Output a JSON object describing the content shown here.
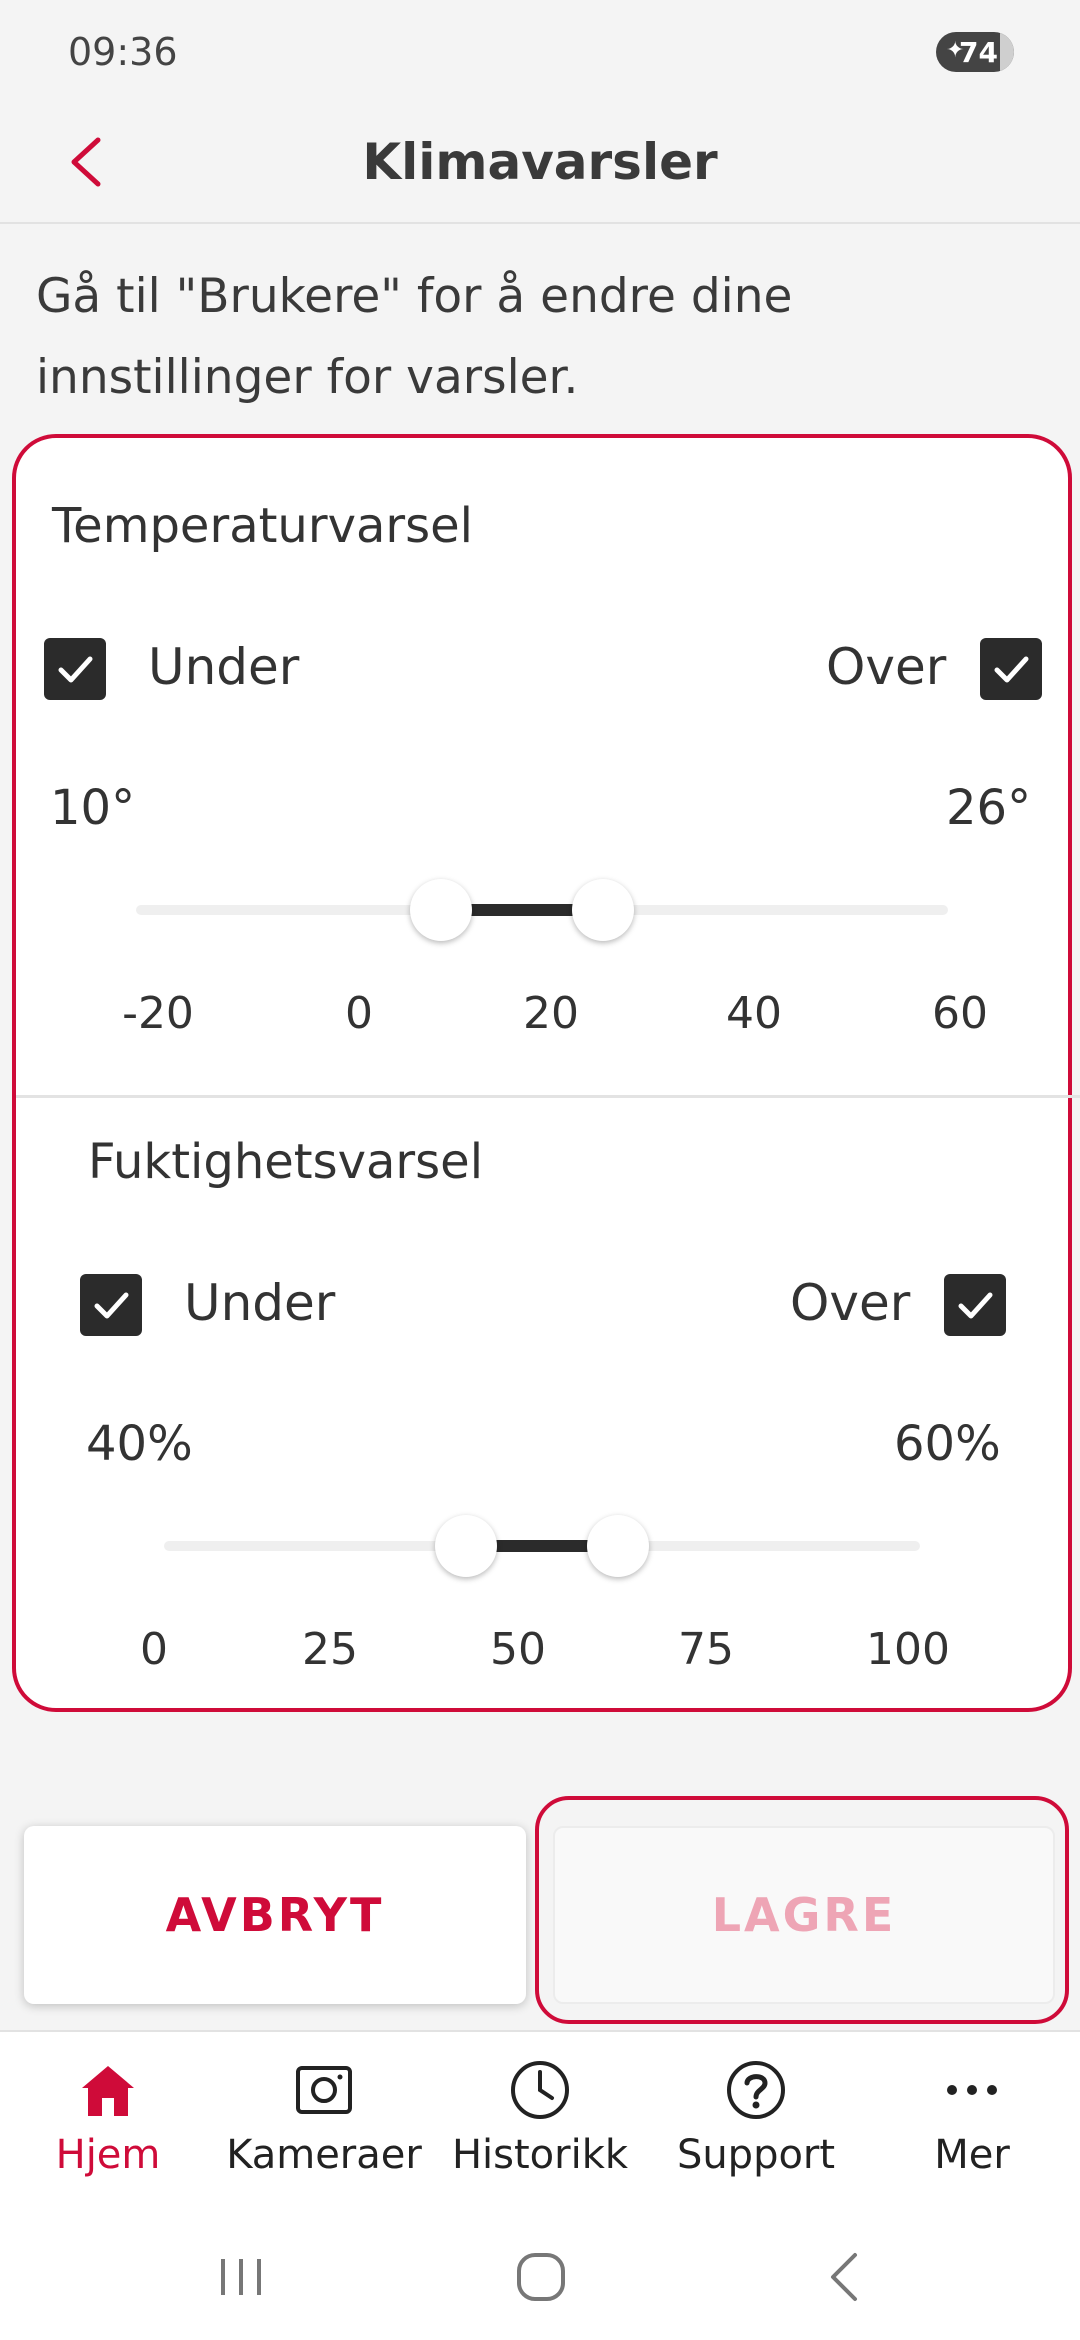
{
  "status_bar": {
    "time": "09:36",
    "battery_level": "74"
  },
  "header": {
    "title": "Klimavarsler"
  },
  "info": {
    "text": "Gå til \"Brukere\" for å endre dine innstillinger for varsler."
  },
  "temperature": {
    "title": "Temperaturvarsel",
    "under_label": "Under",
    "over_label": "Over",
    "under_checked": true,
    "over_checked": true,
    "low_value": "10°",
    "high_value": "26°",
    "slider": {
      "min": -20,
      "max": 60,
      "low": 10,
      "high": 26
    },
    "ticks": [
      "-20",
      "0",
      "20",
      "40",
      "60"
    ]
  },
  "humidity": {
    "title": "Fuktighetsvarsel",
    "under_label": "Under",
    "over_label": "Over",
    "under_checked": true,
    "over_checked": true,
    "low_value": "40%",
    "high_value": "60%",
    "slider": {
      "min": 0,
      "max": 100,
      "low": 40,
      "high": 60
    },
    "ticks": [
      "0",
      "25",
      "50",
      "75",
      "100"
    ]
  },
  "actions": {
    "cancel_label": "AVBRYT",
    "save_label": "LAGRE"
  },
  "bottom_nav": {
    "items": [
      {
        "label": "Hjem",
        "icon": "home-icon",
        "active": true
      },
      {
        "label": "Kameraer",
        "icon": "camera-icon",
        "active": false
      },
      {
        "label": "Historikk",
        "icon": "clock-icon",
        "active": false
      },
      {
        "label": "Support",
        "icon": "help-icon",
        "active": false
      },
      {
        "label": "Mer",
        "icon": "more-icon",
        "active": false
      }
    ]
  },
  "colors": {
    "accent": "#cf0b39",
    "save_disabled_text": "#eea5b5",
    "checkbox": "#2b2b2b",
    "text": "#333333"
  }
}
